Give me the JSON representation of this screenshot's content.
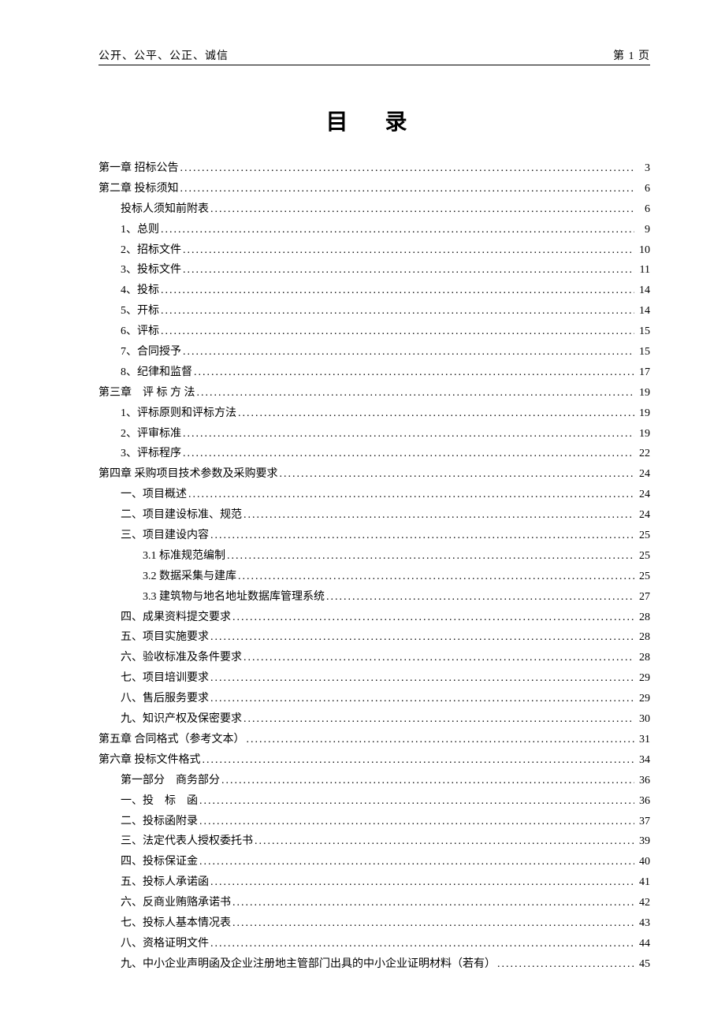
{
  "header": {
    "left": "公开、公平、公正、诚信",
    "right": "第 1 页"
  },
  "title": "目 录",
  "toc": [
    {
      "level": 0,
      "label": "第一章 招标公告",
      "page": "3"
    },
    {
      "level": 0,
      "label": "第二章 投标须知",
      "page": "6"
    },
    {
      "level": 1,
      "label": "投标人须知前附表",
      "page": "6"
    },
    {
      "level": 1,
      "label": "1、总则",
      "page": "9"
    },
    {
      "level": 1,
      "label": "2、招标文件",
      "page": "10"
    },
    {
      "level": 1,
      "label": "3、投标文件",
      "page": "11"
    },
    {
      "level": 1,
      "label": "4、投标",
      "page": "14"
    },
    {
      "level": 1,
      "label": "5、开标",
      "page": "14"
    },
    {
      "level": 1,
      "label": "6、评标",
      "page": "15"
    },
    {
      "level": 1,
      "label": "7、合同授予",
      "page": "15"
    },
    {
      "level": 1,
      "label": "8、纪律和监督",
      "page": "17"
    },
    {
      "level": 0,
      "label": "第三章　评 标 方 法",
      "page": "19"
    },
    {
      "level": 1,
      "label": "1、评标原则和评标方法",
      "page": "19"
    },
    {
      "level": 1,
      "label": "2、评审标准",
      "page": "19"
    },
    {
      "level": 1,
      "label": "3、评标程序",
      "page": "22"
    },
    {
      "level": 0,
      "label": "第四章 采购项目技术参数及采购要求",
      "page": "24"
    },
    {
      "level": 1,
      "label": "一、项目概述",
      "page": "24"
    },
    {
      "level": 1,
      "label": "二、项目建设标准、规范",
      "page": "24"
    },
    {
      "level": 1,
      "label": "三、项目建设内容",
      "page": "25"
    },
    {
      "level": 2,
      "label": "3.1 标准规范编制",
      "page": "25"
    },
    {
      "level": 2,
      "label": "3.2 数据采集与建库",
      "page": "25"
    },
    {
      "level": 2,
      "label": "3.3 建筑物与地名地址数据库管理系统",
      "page": "27"
    },
    {
      "level": 1,
      "label": "四、成果资料提交要求",
      "page": "28"
    },
    {
      "level": 1,
      "label": "五、项目实施要求",
      "page": "28"
    },
    {
      "level": 1,
      "label": "六、验收标准及条件要求",
      "page": "28"
    },
    {
      "level": 1,
      "label": "七、项目培训要求",
      "page": "29"
    },
    {
      "level": 1,
      "label": "八、售后服务要求",
      "page": "29"
    },
    {
      "level": 1,
      "label": "九、知识产权及保密要求",
      "page": "30"
    },
    {
      "level": 0,
      "label": "第五章 合同格式（参考文本）",
      "page": "31"
    },
    {
      "level": 0,
      "label": "第六章 投标文件格式",
      "page": "34"
    },
    {
      "level": 1,
      "label": "第一部分　商务部分",
      "page": "36"
    },
    {
      "level": 1,
      "label": "一、投　标　函",
      "page": "36"
    },
    {
      "level": 1,
      "label": "二、投标函附录",
      "page": "37"
    },
    {
      "level": 1,
      "label": "三、法定代表人授权委托书",
      "page": "39"
    },
    {
      "level": 1,
      "label": "四、投标保证金",
      "page": "40"
    },
    {
      "level": 1,
      "label": "五、投标人承诺函",
      "page": "41"
    },
    {
      "level": 1,
      "label": "六、反商业贿赂承诺书",
      "page": "42"
    },
    {
      "level": 1,
      "label": "七、投标人基本情况表",
      "page": "43"
    },
    {
      "level": 1,
      "label": "八、资格证明文件",
      "page": "44"
    },
    {
      "level": 1,
      "label": "九、中小企业声明函及企业注册地主管部门出具的中小企业证明材料（若有）",
      "page": "45"
    }
  ]
}
